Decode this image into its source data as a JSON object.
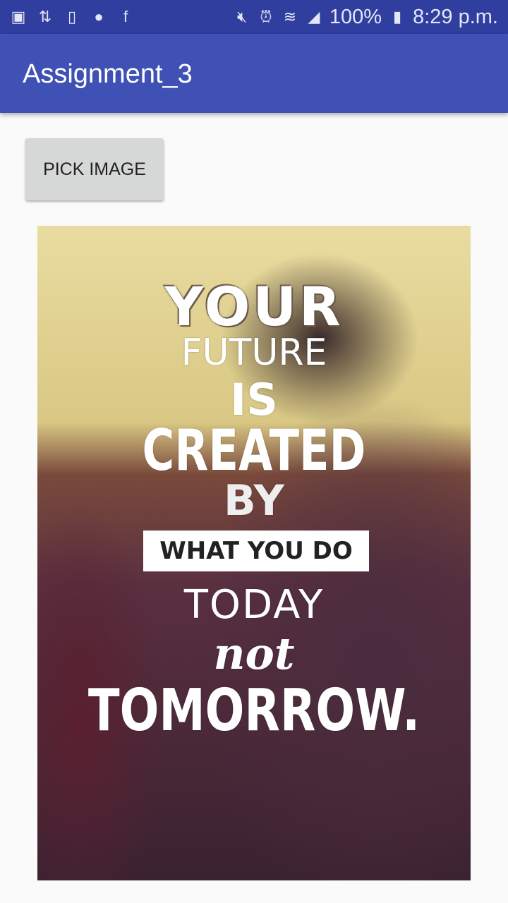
{
  "status_bar": {
    "left_icons": [
      "gallery-icon",
      "data-transfer-icon",
      "phone-clock-icon",
      "messenger-icon",
      "facebook-icon"
    ],
    "right_icons": [
      "mute-icon",
      "alarm-icon",
      "wifi-icon",
      "signal-icon",
      "battery-icon"
    ],
    "battery": "100%",
    "time": "8:29 p.m."
  },
  "app_bar": {
    "title": "Assignment_3",
    "color": "#3f51b5"
  },
  "pick_button": "PICK IMAGE",
  "image": {
    "lines": [
      "YOUR",
      "FUTURE",
      "IS",
      "CREATED",
      "BY",
      "WHAT YOU DO",
      "TODAY",
      "not",
      "TOMORROW."
    ]
  }
}
